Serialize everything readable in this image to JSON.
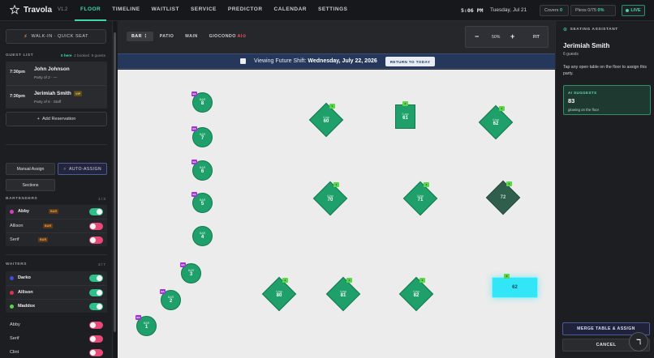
{
  "app": {
    "name": "Travola",
    "version": "V1.2",
    "icon": "star-icon"
  },
  "nav": [
    {
      "label": "FLOOR",
      "active": true
    },
    {
      "label": "TIMELINE"
    },
    {
      "label": "WAITLIST"
    },
    {
      "label": "SERVICE"
    },
    {
      "label": "PREDICTOR"
    },
    {
      "label": "CALENDAR"
    },
    {
      "label": "SETTINGS"
    }
  ],
  "status": {
    "time": "5:06 PM",
    "date": "Tuesday, Jul 21",
    "covers_label": "Covers",
    "covers_value": "0",
    "pleos_label": "Pleos",
    "pleos_value": "0/75",
    "pleos_pct": "0%",
    "live_label": "LIVE"
  },
  "left": {
    "walkin_label": "WALK-IN · QUICK SEAT",
    "guest_list": {
      "title": "GUEST LIST",
      "here": "0 here",
      "booked": "2 booked",
      "guests": "8 guests",
      "items": [
        {
          "time": "7:30pm",
          "name": "John Johnson",
          "sub": "Party of 2 · —",
          "vip": ""
        },
        {
          "time": "7:30pm",
          "name": "Jerimiah Smith",
          "sub": "Party of 6 · Staff",
          "vip": "VIP"
        }
      ]
    },
    "add_reservation": "Add Reservation",
    "manual_assign": "Manual Assign",
    "auto_assign": "AUTO-ASSIGN",
    "sections": "Sections",
    "bartenders": {
      "title": "BARTENDERS",
      "count": "1 / 3",
      "items": [
        {
          "name": "Abby",
          "tag": "BAR",
          "on": true,
          "dot": "#d63cc4"
        },
        {
          "name": "Allison",
          "tag": "BAR",
          "on": false,
          "dot": ""
        },
        {
          "name": "Serif",
          "tag": "BAR",
          "on": false,
          "dot": ""
        }
      ]
    },
    "waiters": {
      "title": "WAITERS",
      "count": "3 / 7",
      "items": [
        {
          "name": "Darko",
          "on": true,
          "dot": "#3a4fe0"
        },
        {
          "name": "Allison",
          "on": true,
          "dot": "#d8344a"
        },
        {
          "name": "Maddox",
          "on": true,
          "dot": "#58d64a"
        },
        {
          "name": "Abby",
          "on": false,
          "dot": ""
        },
        {
          "name": "Serif",
          "on": false,
          "dot": ""
        },
        {
          "name": "Clint",
          "on": false,
          "dot": ""
        }
      ]
    }
  },
  "floor": {
    "zones": [
      "BAR",
      "PATIO",
      "MAIN",
      "GIOCONDO"
    ],
    "zone_ai": "AI",
    "zoom": "50%",
    "fit_label": "FIT",
    "banner_prefix": "Viewing Future Shift: ",
    "banner_date": "Wednesday, July 22, 2026",
    "return_label": "RETURN TO TODAY",
    "bar_seats": [
      {
        "cap": "BAR",
        "num": "8",
        "badge": "BA"
      },
      {
        "cap": "BAR",
        "num": "7",
        "badge": "BA"
      },
      {
        "cap": "BAR",
        "num": "6",
        "badge": "BA"
      },
      {
        "cap": "BAR",
        "num": "5",
        "badge": "BA"
      },
      {
        "cap": "BAR",
        "num": "4",
        "badge": ""
      },
      {
        "cap": "BAR",
        "num": "3",
        "badge": "BA"
      },
      {
        "cap": "BAR",
        "num": "2",
        "badge": "BA"
      },
      {
        "cap": "BAR",
        "num": "1",
        "badge": "BA"
      }
    ],
    "diamonds": [
      {
        "cap": "4-top",
        "num": "60",
        "badge": "4"
      },
      {
        "cap": "4-top",
        "num": "62",
        "badge": "4"
      },
      {
        "cap": "4-top",
        "num": "70",
        "badge": "4"
      },
      {
        "cap": "4-top",
        "num": "71",
        "badge": "4"
      },
      {
        "cap": "",
        "num": "72",
        "badge": "4",
        "dim": true
      },
      {
        "cap": "4-top",
        "num": "80",
        "badge": "4"
      },
      {
        "cap": "4-top",
        "num": "81",
        "badge": "4"
      },
      {
        "cap": "4-top",
        "num": "82",
        "badge": "4"
      }
    ],
    "rect": {
      "cap": "2-top",
      "num": "61",
      "badge": "2"
    },
    "highlight": {
      "num": "62",
      "badge": "6"
    }
  },
  "right": {
    "title": "SEATING ASSISTANT",
    "name": "Jerimiah Smith",
    "guests": "6 guests",
    "info": "Tap any open table on the floor to assign this party.",
    "ai_title": "AI SUGGESTS",
    "ai_num": "83",
    "ai_sub": "glowing on the floor",
    "merge": "MERGE TABLE & ASSIGN",
    "cancel": "CANCEL"
  }
}
